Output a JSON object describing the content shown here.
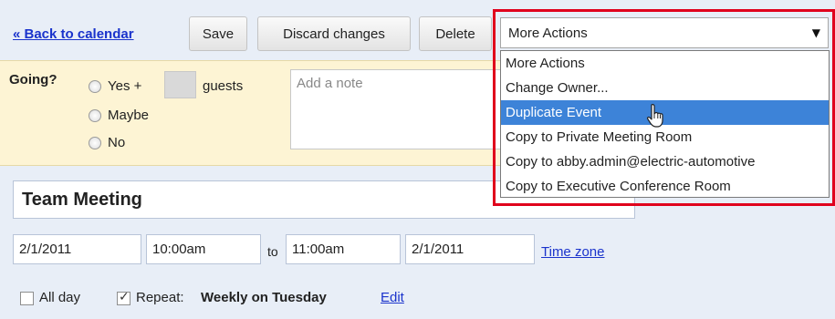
{
  "toolbar": {
    "back_link": "« Back to calendar",
    "save_label": "Save",
    "discard_label": "Discard changes",
    "delete_label": "Delete"
  },
  "actions_dropdown": {
    "selected": "More Actions",
    "options": [
      "More Actions",
      "Change Owner...",
      "Duplicate Event",
      "Copy to Private Meeting Room",
      "Copy to abby.admin@electric-automotive",
      "Copy to Executive Conference Room"
    ],
    "highlighted_index": 2,
    "highlight_color": "#3d83d8",
    "callout_color": "#e0001c"
  },
  "rsvp": {
    "question": "Going?",
    "yes_label": "Yes +",
    "guests_label": "guests",
    "maybe_label": "Maybe",
    "no_label": "No",
    "note_placeholder": "Add a note"
  },
  "event": {
    "title": "Team Meeting",
    "start_date": "2/1/2011",
    "start_time": "10:00am",
    "to_label": "to",
    "end_time": "11:00am",
    "end_date": "2/1/2011",
    "time_zone_link": "Time zone",
    "all_day_label": "All day",
    "all_day_checked": false,
    "repeat_label": "Repeat:",
    "repeat_value": "Weekly on Tuesday",
    "repeat_checked": true,
    "edit_link": "Edit"
  },
  "colors": {
    "rsvp_background": "#fdf4d4",
    "page_background": "#e8eef7",
    "link": "#1a33cc"
  }
}
